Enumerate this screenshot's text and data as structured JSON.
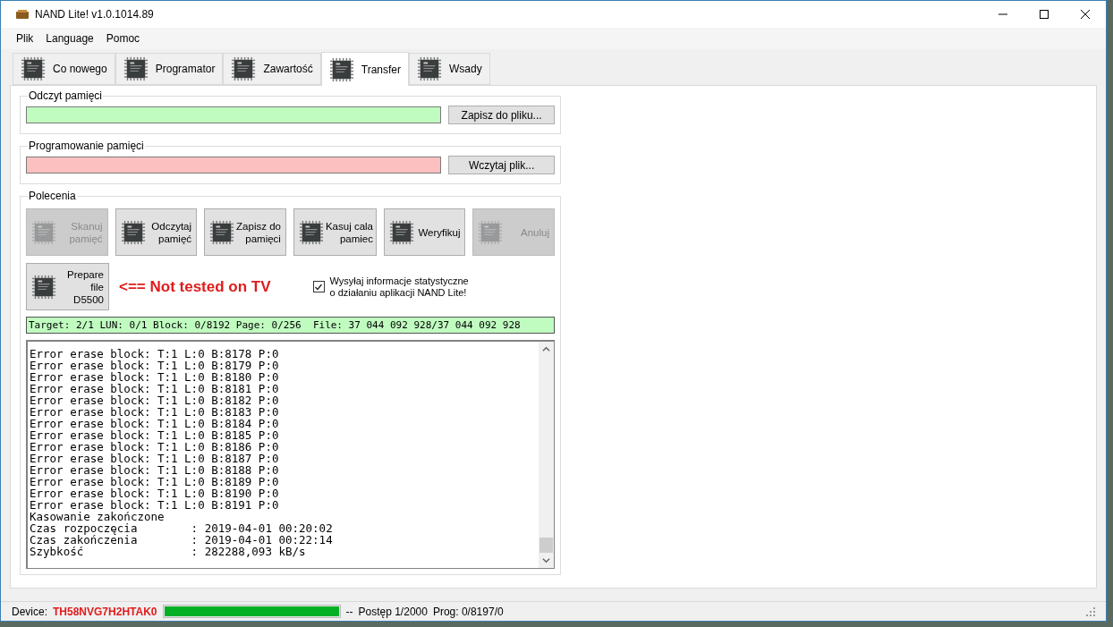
{
  "window": {
    "title": "NAND Lite! v1.0.1014.89"
  },
  "menu": [
    "Plik",
    "Language",
    "Pomoc"
  ],
  "tabs": [
    {
      "label": "Co nowego",
      "selected": false
    },
    {
      "label": "Programator",
      "selected": false
    },
    {
      "label": "Zawartość",
      "selected": false
    },
    {
      "label": "Transfer",
      "selected": true
    },
    {
      "label": "Wsady",
      "selected": false
    }
  ],
  "read_group": {
    "title": "Odczyt pamięci",
    "button": "Zapisz do pliku..."
  },
  "program_group": {
    "title": "Programowanie pamięci",
    "button": "Wczytaj plik..."
  },
  "commands": {
    "title": "Polecenia",
    "buttons": [
      {
        "label": "Skanuj\npamięć",
        "disabled": true
      },
      {
        "label": "Odczytaj\npamięć",
        "disabled": false
      },
      {
        "label": "Zapisz do\npamięci",
        "disabled": false
      },
      {
        "label": "Kasuj cala\npamiec",
        "disabled": false
      },
      {
        "label": "Weryfikuj",
        "disabled": false
      },
      {
        "label": "Anuluj",
        "disabled": true
      }
    ],
    "prepare_button": {
      "label": "Prepare\nfile\nD5500",
      "disabled": false
    },
    "warning": "<== Not tested on TV",
    "stats_checkbox": {
      "label": "Wysyłaj informacje statystyczne\no działaniu aplikacji NAND Lite!",
      "checked": true
    }
  },
  "status_line": "Target: 2/1 LUN: 0/1 Block: 0/8192 Page: 0/256  File: 37 044 092 928/37 044 092 928",
  "log": [
    "Error erase block: T:1 L:0 B:8178 P:0",
    "Error erase block: T:1 L:0 B:8179 P:0",
    "Error erase block: T:1 L:0 B:8180 P:0",
    "Error erase block: T:1 L:0 B:8181 P:0",
    "Error erase block: T:1 L:0 B:8182 P:0",
    "Error erase block: T:1 L:0 B:8183 P:0",
    "Error erase block: T:1 L:0 B:8184 P:0",
    "Error erase block: T:1 L:0 B:8185 P:0",
    "Error erase block: T:1 L:0 B:8186 P:0",
    "Error erase block: T:1 L:0 B:8187 P:0",
    "Error erase block: T:1 L:0 B:8188 P:0",
    "Error erase block: T:1 L:0 B:8189 P:0",
    "Error erase block: T:1 L:0 B:8190 P:0",
    "Error erase block: T:1 L:0 B:8191 P:0",
    "Kasowanie zakończone",
    "Czas rozpoczęcia        : 2019-04-01 00:20:02",
    "Czas zakończenia        : 2019-04-01 00:22:14",
    "Szybkość                : 282288,093 kB/s"
  ],
  "status_bar": {
    "device_label": "Device:",
    "device": "TH58NVG7H2HTAK0",
    "progress": {
      "level": 1
    },
    "dashes": "--",
    "progress_text": "Postęp 1/2000",
    "prog": "Prog: 0/8197/0"
  }
}
